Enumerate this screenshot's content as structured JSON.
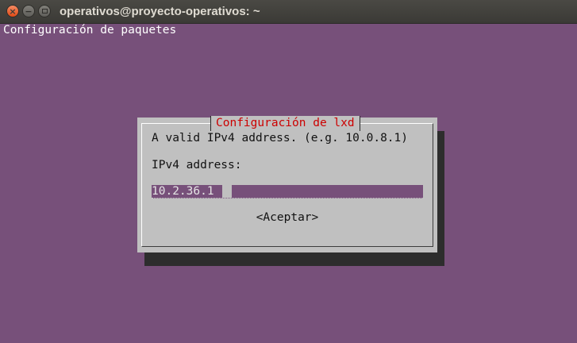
{
  "window": {
    "title": "operativos@proyecto-operativos: ~",
    "controls": {
      "close": "×",
      "minimize": "−"
    }
  },
  "terminal": {
    "header": "Configuración de paquetes"
  },
  "dialog": {
    "title": "Configuración de lxd",
    "message": "A valid IPv4 address. (e.g. 10.0.8.1)",
    "field_label": "IPv4 address:",
    "field_value": "10.2.36.1",
    "ok_button": "<Aceptar>"
  },
  "colors": {
    "terminal_bg": "#77507a",
    "dialog_bg": "#c0c0c0",
    "dialog_title": "#cc0000",
    "shadow": "#2d2d2d"
  }
}
